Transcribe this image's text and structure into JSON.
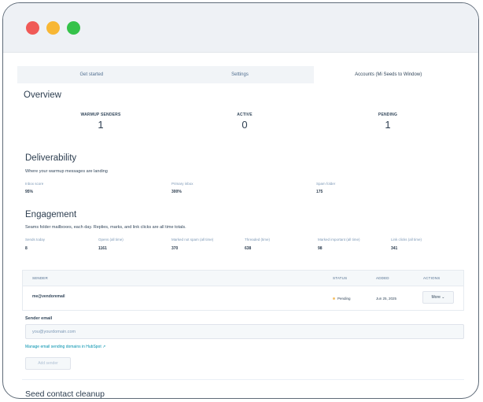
{
  "tabs": [
    {
      "label": "Get started",
      "active": false
    },
    {
      "label": "Settings",
      "active": false
    },
    {
      "label": "Accounts (Mi Seeds to Window)",
      "active": true
    }
  ],
  "overview": {
    "title": "Overview",
    "stats": [
      {
        "label": "WARMUP SENDERS",
        "value": "1"
      },
      {
        "label": "ACTIVE",
        "value": "0"
      },
      {
        "label": "PENDING",
        "value": "1"
      }
    ]
  },
  "deliverability": {
    "title": "Deliverability",
    "subtitle": "Where your warmup messages are landing",
    "metrics": [
      {
        "label": "Inbox score",
        "value": "95%"
      },
      {
        "label": "Primary inbox",
        "value": "300%"
      },
      {
        "label": "Spam folder",
        "value": "175"
      }
    ]
  },
  "engagement": {
    "title": "Engagement",
    "subtitle": "Seams folder mailboxes, each day. Replies, marks, and link clicks are all time totals.",
    "metrics": [
      {
        "label": "Sends today",
        "value": "8"
      },
      {
        "label": "Opens (all time)",
        "value": "1161"
      },
      {
        "label": "Marked not spam (all time)",
        "value": "370"
      },
      {
        "label": "Threaded (time)",
        "value": "638"
      },
      {
        "label": "Marked important (all time)",
        "value": "98"
      },
      {
        "label": "Link clicks (all time)",
        "value": "341"
      }
    ]
  },
  "table": {
    "headers": [
      "SENDER",
      "STATUS",
      "ADDED",
      "ACTIONS"
    ],
    "rows": [
      {
        "sender": "me@vendoremail",
        "status": "Pending",
        "added": "Jun 25, 2025",
        "action": "More ⌄"
      }
    ]
  },
  "form": {
    "label": "Sender email",
    "placeholder": "you@yourdomain.com",
    "link": "Manage email sending domains in HubSpot ↗",
    "button": "Add sender"
  },
  "seed": {
    "title": "Seed contact cleanup"
  }
}
